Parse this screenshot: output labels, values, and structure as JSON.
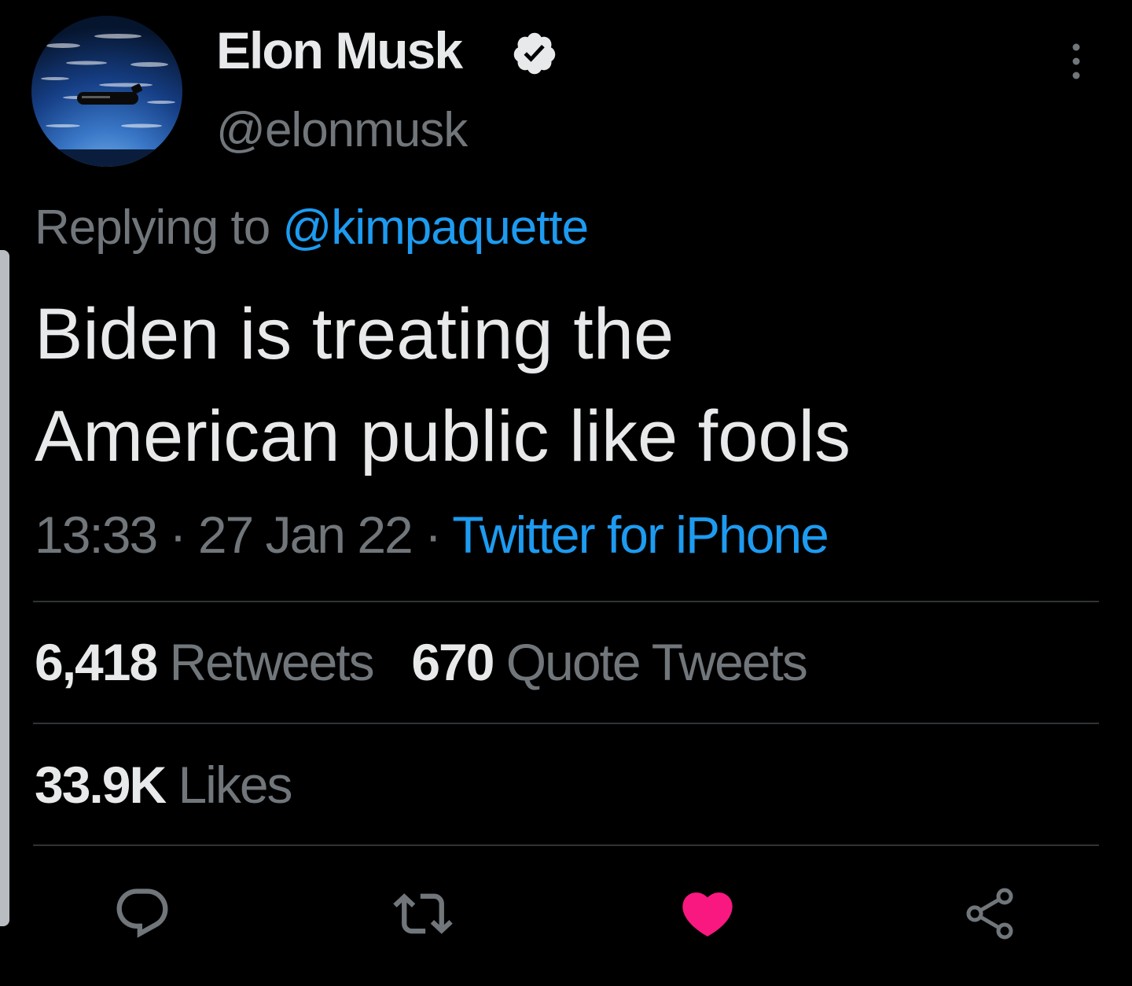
{
  "author": {
    "display_name": "Elon Musk",
    "handle": "@elonmusk",
    "verified": true
  },
  "reply": {
    "prefix": "Replying to",
    "mention": "@kimpaquette"
  },
  "tweet": {
    "lines": [
      "Biden is treating the",
      "American public like fools"
    ],
    "time": "13:33",
    "separator": "·",
    "date": "27 Jan 22",
    "source": "Twitter for iPhone"
  },
  "stats": {
    "retweets_count": "6,418",
    "retweets_label": "Retweets",
    "quotes_count": "670",
    "quotes_label": "Quote Tweets",
    "likes_count": "33.9K",
    "likes_label": "Likes"
  },
  "icons": {
    "verified": "verified-badge-icon",
    "more": "more-vertical-icon",
    "reply": "reply-icon",
    "retweet": "retweet-icon",
    "like": "heart-icon",
    "share": "share-icon"
  },
  "colors": {
    "background": "#000000",
    "text_primary": "#e7e9ea",
    "text_secondary": "#71767b",
    "accent_blue": "#1d9bf0",
    "like_pink": "#f91880",
    "divider": "#2f3336"
  }
}
